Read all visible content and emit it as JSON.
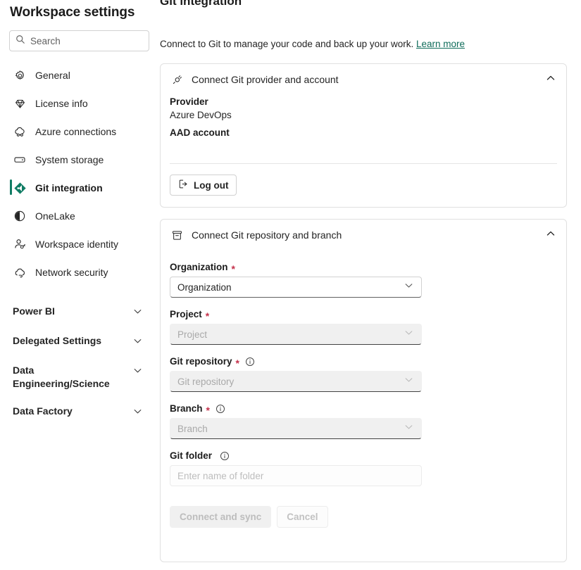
{
  "page": {
    "title": "Workspace settings",
    "clipped_heading": "Git integration",
    "intro_text": "Connect to Git to manage your code and back up your work.",
    "learn_more": "Learn more",
    "accent_color": "#107c64",
    "required_color": "#c4314b"
  },
  "search": {
    "placeholder": "Search",
    "value": "",
    "icon": "search-icon"
  },
  "sidebar": {
    "items": [
      {
        "label": "General",
        "icon": "gear-icon",
        "selected": false
      },
      {
        "label": "License info",
        "icon": "diamond-icon",
        "selected": false
      },
      {
        "label": "Azure connections",
        "icon": "cloud-link-icon",
        "selected": false
      },
      {
        "label": "System storage",
        "icon": "storage-icon",
        "selected": false
      },
      {
        "label": "Git integration",
        "icon": "git-diamond-icon",
        "selected": true
      },
      {
        "label": "OneLake",
        "icon": "onelake-icon",
        "selected": false
      },
      {
        "label": "Workspace identity",
        "icon": "person-key-icon",
        "selected": false
      },
      {
        "label": "Network security",
        "icon": "cloud-network-icon",
        "selected": false
      }
    ],
    "groups": [
      {
        "label": "Power BI",
        "icon": "chevron-down-icon"
      },
      {
        "label": "Delegated Settings",
        "icon": "chevron-down-icon"
      },
      {
        "label": "Data Engineering/Science",
        "icon": "chevron-down-icon"
      },
      {
        "label": "Data Factory",
        "icon": "chevron-down-icon"
      }
    ]
  },
  "provider_card": {
    "title": "Connect Git provider and account",
    "icon": "plug-icon",
    "collapse_icon": "chevron-up-icon",
    "provider_label": "Provider",
    "provider_value": "Azure DevOps",
    "account_label": "AAD account",
    "account_value": "",
    "logout_label": "Log out",
    "logout_icon": "sign-out-icon"
  },
  "repo_card": {
    "title": "Connect Git repository and branch",
    "icon": "archive-box-icon",
    "collapse_icon": "chevron-up-icon",
    "fields": [
      {
        "label": "Organization",
        "required": true,
        "info": false,
        "value": "Organization",
        "placeholder": "Organization",
        "disabled": false,
        "type": "select"
      },
      {
        "label": "Project",
        "required": true,
        "info": false,
        "value": "Project",
        "placeholder": "Project",
        "disabled": true,
        "type": "select"
      },
      {
        "label": "Git repository",
        "required": true,
        "info": true,
        "value": "Git repository",
        "placeholder": "Git repository",
        "disabled": true,
        "type": "select"
      },
      {
        "label": "Branch",
        "required": true,
        "info": true,
        "value": "Branch",
        "placeholder": "Branch",
        "disabled": true,
        "type": "select"
      },
      {
        "label": "Git folder",
        "required": false,
        "info": true,
        "value": "",
        "placeholder": "Enter name of folder",
        "disabled": false,
        "type": "text"
      }
    ],
    "connect_label": "Connect and sync",
    "cancel_label": "Cancel"
  }
}
